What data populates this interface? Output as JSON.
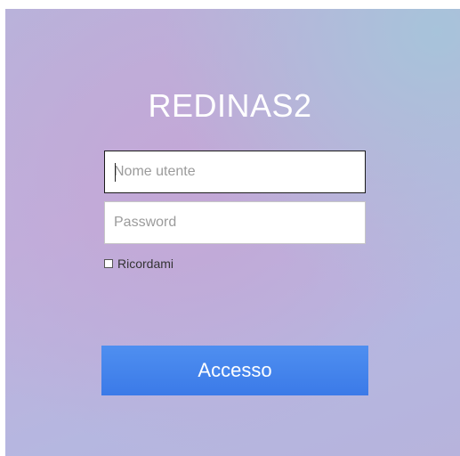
{
  "app": {
    "title": "REDINAS2"
  },
  "form": {
    "username_placeholder": "Nome utente",
    "username_value": "",
    "password_placeholder": "Password",
    "password_value": "",
    "remember_label": "Ricordami",
    "remember_checked": false,
    "submit_label": "Accesso"
  },
  "colors": {
    "button": "#4285f4",
    "title_text": "#ffffff"
  }
}
